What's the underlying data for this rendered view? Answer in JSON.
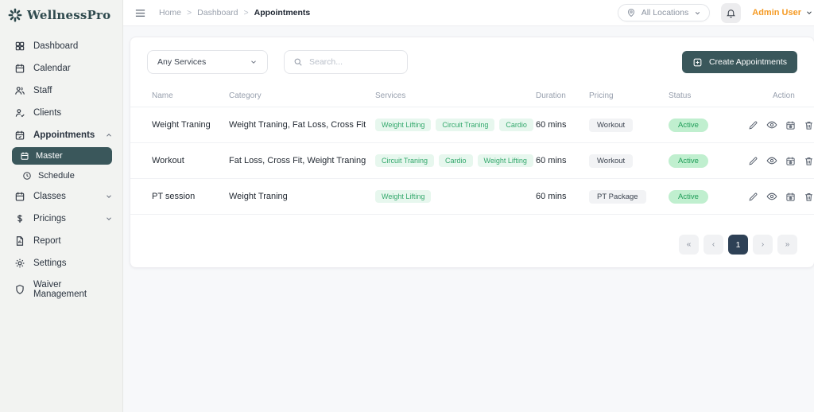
{
  "brand": {
    "name": "WellnessPro"
  },
  "sidebar": {
    "items": [
      {
        "label": "Dashboard"
      },
      {
        "label": "Calendar"
      },
      {
        "label": "Staff"
      },
      {
        "label": "Clients"
      },
      {
        "label": "Appointments",
        "expanded": true,
        "children": [
          {
            "label": "Master",
            "active": true
          },
          {
            "label": "Schedule"
          }
        ]
      },
      {
        "label": "Classes"
      },
      {
        "label": "Pricings"
      },
      {
        "label": "Report"
      },
      {
        "label": "Settings"
      },
      {
        "label": "Waiver Management"
      }
    ]
  },
  "topbar": {
    "breadcrumb": [
      "Home",
      "Dashboard",
      "Appointments"
    ],
    "separator": ">",
    "location_selector": {
      "label": "All Locations"
    },
    "user": {
      "name": "Admin User"
    }
  },
  "filters": {
    "service_filter": {
      "value": "Any Services"
    },
    "search": {
      "placeholder": "Search..."
    }
  },
  "toolbar": {
    "create_label": "Create Appointments"
  },
  "table": {
    "columns": [
      "Name",
      "Category",
      "Services",
      "Duration",
      "Pricing",
      "Status",
      "Action"
    ],
    "rows": [
      {
        "name": "Weight Traning",
        "category": "Weight Traning, Fat Loss, Cross Fit",
        "services": [
          "Weight Lifting",
          "Circuit Traning",
          "Cardio"
        ],
        "duration": "60 mins",
        "pricing": "Workout",
        "status": "Active"
      },
      {
        "name": "Workout",
        "category": "Fat Loss, Cross Fit, Weight Traning",
        "services": [
          "Circuit Traning",
          "Cardio",
          "Weight Lifting"
        ],
        "duration": "60 mins",
        "pricing": "Workout",
        "status": "Active"
      },
      {
        "name": "PT session",
        "category": "Weight Traning",
        "services": [
          "Weight Lifting"
        ],
        "duration": "60 mins",
        "pricing": "PT Package",
        "status": "Active"
      }
    ]
  },
  "pagination": {
    "first": "«",
    "prev": "‹",
    "current": "1",
    "next": "›",
    "last": "»"
  },
  "icons": {
    "logo": "flower-burst",
    "sidebar": [
      "grid",
      "calendar",
      "users",
      "user-check",
      "calendar-check",
      "calendar",
      "dollar",
      "file-report",
      "gear",
      "shield"
    ],
    "actions": [
      "pencil-edit",
      "eye-view",
      "calendar-clock",
      "trash-delete"
    ]
  },
  "colors": {
    "accent": "#3a575b",
    "sidebar_bg": "#f2f3f1",
    "user_orange": "#f59a23",
    "badge_green_bg": "#e7f7ee",
    "badge_green_text": "#33a86c",
    "status_bg": "#c0efcf",
    "status_text": "#1f9d58",
    "pagination_active_bg": "#2e4156"
  }
}
